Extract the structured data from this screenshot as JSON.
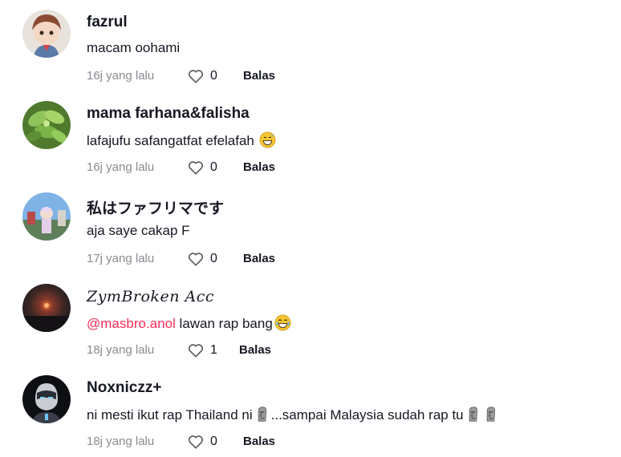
{
  "comments": [
    {
      "username": "fazrul",
      "text": "macam oohami",
      "time": "16j yang lalu",
      "likes": "0",
      "reply_label": "Balas",
      "avatar_icon": "anime-character-avatar"
    },
    {
      "username": "mama farhana&falisha",
      "text": "lafajufu safangatfat efelafah",
      "emoji": "grinning-sweat-emoji",
      "time": "16j yang lalu",
      "likes": "0",
      "reply_label": "Balas",
      "avatar_icon": "plant-avatar"
    },
    {
      "username": "私はファフリマです",
      "text": "aja saye cakap F",
      "time": "17j yang lalu",
      "likes": "0",
      "reply_label": "Balas",
      "avatar_icon": "game-character-avatar"
    },
    {
      "username": "ZymBroken Acc",
      "mention": "@masbro.anol",
      "text": " lawan rap bang",
      "emoji": "tears-of-joy-emoji",
      "time": "18j yang lalu",
      "likes": "1",
      "reply_label": "Balas",
      "avatar_icon": "sunset-avatar"
    },
    {
      "username": "Noxniczz+",
      "text": "ni mesti ikut rap Thailand ni",
      "text2": "...sampai Malaysia sudah rap tu",
      "emoji": "moai-emoji",
      "time": "18j yang lalu",
      "likes": "0",
      "reply_label": "Balas",
      "avatar_icon": "masked-character-avatar"
    }
  ],
  "colors": {
    "mention": "#fe2c55",
    "meta": "#8a8b91",
    "text": "#161823"
  }
}
